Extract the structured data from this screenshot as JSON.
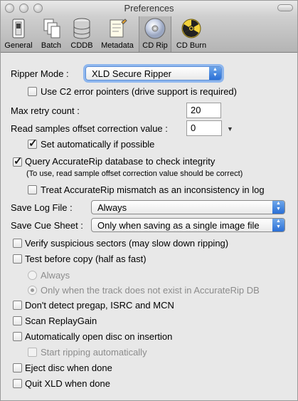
{
  "window": {
    "title": "Preferences"
  },
  "toolbar": {
    "items": [
      {
        "label": "General",
        "icon": "switch-icon"
      },
      {
        "label": "Batch",
        "icon": "documents-icon"
      },
      {
        "label": "CDDB",
        "icon": "database-icon"
      },
      {
        "label": "Metadata",
        "icon": "edit-document-icon"
      },
      {
        "label": "CD Rip",
        "icon": "cd-icon",
        "selected": true
      },
      {
        "label": "CD Burn",
        "icon": "radiation-icon"
      }
    ]
  },
  "form": {
    "ripper_mode_label": "Ripper Mode :",
    "ripper_mode_value": "XLD Secure Ripper",
    "c2_label": "Use C2 error pointers (drive support is required)",
    "max_retry_label": "Max retry count :",
    "max_retry_value": "20",
    "offset_label": "Read samples offset correction value :",
    "offset_value": "0",
    "set_auto_label": "Set automatically if possible",
    "accuraterip_label": "Query AccurateRip database to check integrity",
    "accuraterip_note": "(To use, read sample offset correction value should be correct)",
    "treat_mismatch_label": "Treat AccurateRip mismatch as an inconsistency in log",
    "save_log_label": "Save Log File :",
    "save_log_value": "Always",
    "save_cue_label": "Save Cue Sheet :",
    "save_cue_value": "Only when saving as a single image file",
    "verify_label": "Verify suspicious sectors (may slow down ripping)",
    "test_before_label": "Test before copy (half as fast)",
    "radio_always_label": "Always",
    "radio_only_label": "Only when the track does not exist in AccurateRip DB",
    "no_pregap_label": "Don't detect pregap, ISRC and MCN",
    "replaygain_label": "Scan ReplayGain",
    "auto_open_label": "Automatically open disc on insertion",
    "start_ripping_label": "Start ripping automatically",
    "eject_label": "Eject disc when done",
    "quit_label": "Quit XLD when done"
  }
}
